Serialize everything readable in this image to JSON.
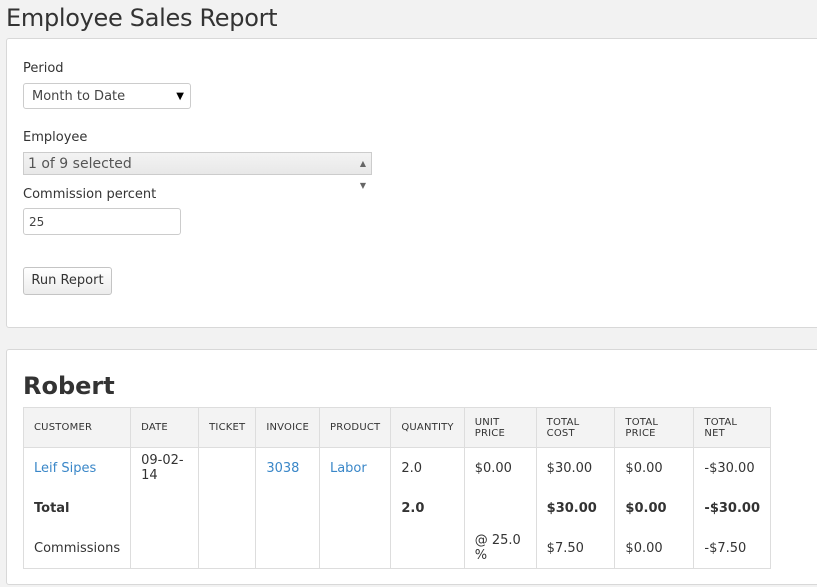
{
  "page_title": "Employee Sales Report",
  "form": {
    "period_label": "Period",
    "period_value": "Month to Date",
    "employee_label": "Employee",
    "employee_value": "1 of 9 selected",
    "commission_label": "Commission percent",
    "commission_value": "25",
    "run_button": "Run Report"
  },
  "report": {
    "employee_name": "Robert",
    "columns": [
      "CUSTOMER",
      "DATE",
      "TICKET",
      "INVOICE",
      "PRODUCT",
      "QUANTITY",
      "UNIT PRICE",
      "TOTAL COST",
      "TOTAL PRICE",
      "TOTAL NET"
    ],
    "row": {
      "customer": "Leif Sipes",
      "date": "09-02-14",
      "ticket": "",
      "invoice": "3038",
      "product": "Labor",
      "quantity": "2.0",
      "unit_price": "$0.00",
      "total_cost": "$30.00",
      "total_price": "$0.00",
      "total_net": "-$30.00"
    },
    "total": {
      "label": "Total",
      "quantity": "2.0",
      "total_cost": "$30.00",
      "total_price": "$0.00",
      "total_net": "-$30.00"
    },
    "commissions": {
      "label": "Commissions",
      "rate": "@ 25.0 %",
      "total_cost": "$7.50",
      "total_price": "$0.00",
      "total_net": "-$7.50"
    }
  },
  "colors": {
    "link": "#3a87c8",
    "background": "#f2f2f2"
  },
  "icons": {
    "period_caret": "caret-down-icon",
    "employee_updown": "updown-arrows-icon"
  }
}
